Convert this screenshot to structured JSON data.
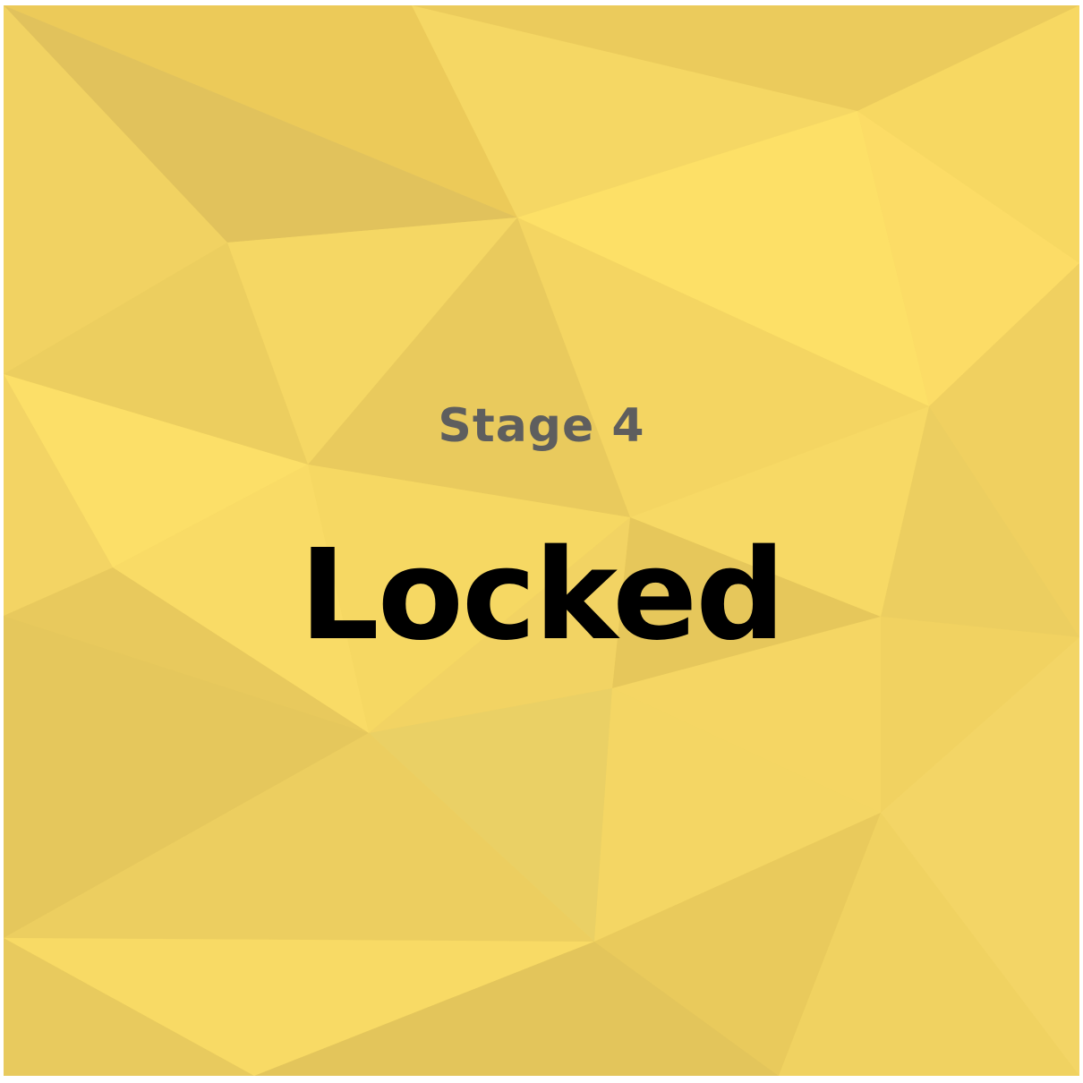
{
  "card": {
    "stage_label": "Stage 4",
    "status_label": "Locked",
    "state": "locked",
    "colors": {
      "base": "#f2d45f",
      "text_stage": "#5e5e5e",
      "text_status": "#000000"
    }
  }
}
